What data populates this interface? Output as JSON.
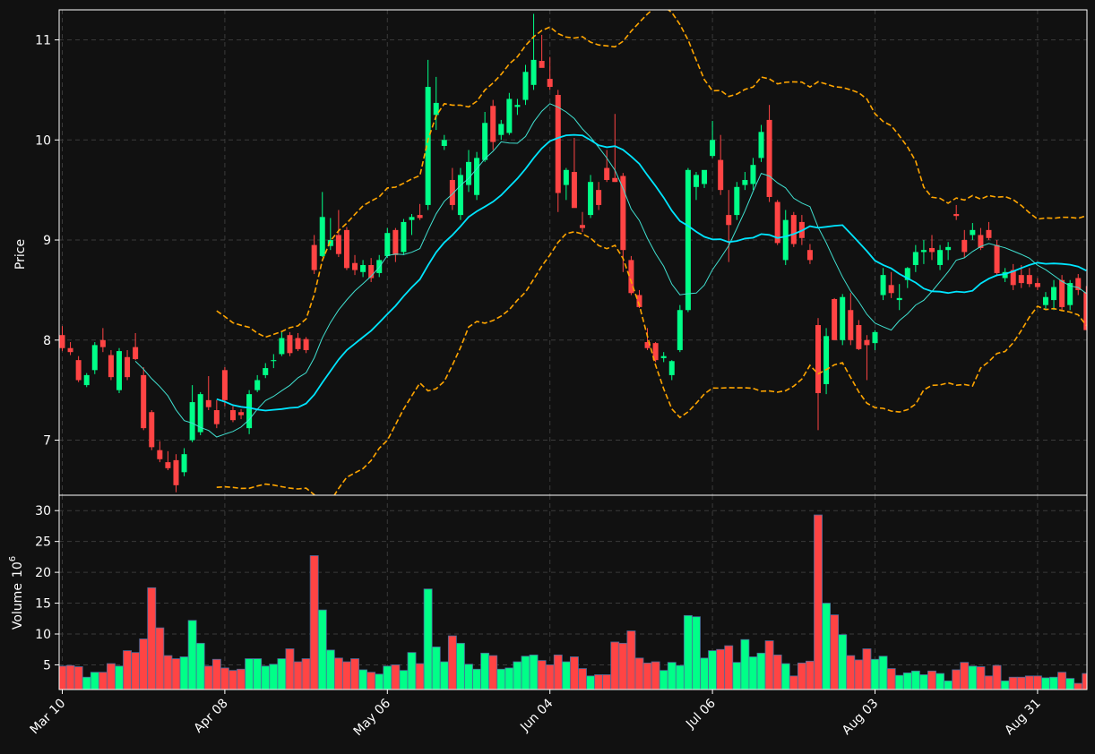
{
  "chart_data": {
    "type": "candlestick",
    "panels": [
      {
        "name": "price",
        "ylabel": "Price",
        "ylim": [
          6.45,
          11.3
        ],
        "yticks": [
          7,
          8,
          9,
          10,
          11
        ]
      },
      {
        "name": "volume",
        "ylabel": "Volume",
        "ylabel_exponent": "10",
        "ylabel_exponent_power": "6",
        "ylim": [
          1,
          32.5
        ],
        "yticks": [
          5,
          10,
          15,
          20,
          25,
          30
        ]
      }
    ],
    "grid": true,
    "xtick_labels": [
      "Mar 10",
      "Apr 08",
      "May 06",
      "Jun 04",
      "Jul 06",
      "Aug 03",
      "Aug 31"
    ],
    "xtick_indices": [
      0,
      20,
      40,
      60,
      80,
      100,
      120
    ],
    "colors": {
      "up": "#00ff88",
      "down": "#ff4444",
      "ma_short": "#40e0d0",
      "ma_long": "#00e5ff",
      "bands": "#ffa500",
      "background": "#111111",
      "grid": "#3a3a3a",
      "axis": "#ffffff",
      "volume_edge": "#4a6b9b"
    },
    "moving_averages": [
      {
        "window": 10,
        "style": "thin"
      },
      {
        "window": 20,
        "style": "thick"
      }
    ],
    "bollinger": {
      "window": 20,
      "k": 2
    },
    "candles": [
      [
        8.05,
        8.14,
        7.89,
        7.92
      ],
      [
        7.92,
        7.98,
        7.85,
        7.88
      ],
      [
        7.8,
        7.84,
        7.58,
        7.6
      ],
      [
        7.55,
        7.67,
        7.53,
        7.65
      ],
      [
        7.7,
        7.98,
        7.66,
        7.95
      ],
      [
        8.0,
        8.12,
        7.88,
        7.93
      ],
      [
        7.85,
        7.9,
        7.6,
        7.63
      ],
      [
        7.5,
        7.92,
        7.47,
        7.89
      ],
      [
        7.83,
        7.9,
        7.6,
        7.63
      ],
      [
        7.93,
        8.07,
        7.8,
        7.81
      ],
      [
        7.65,
        7.73,
        7.1,
        7.12
      ],
      [
        7.28,
        7.3,
        6.9,
        6.93
      ],
      [
        6.9,
        6.99,
        6.78,
        6.81
      ],
      [
        6.78,
        6.89,
        6.7,
        6.72
      ],
      [
        6.8,
        6.86,
        6.48,
        6.55
      ],
      [
        6.68,
        6.92,
        6.64,
        6.86
      ],
      [
        7.0,
        7.55,
        6.98,
        7.38
      ],
      [
        7.08,
        7.48,
        7.05,
        7.46
      ],
      [
        7.4,
        7.64,
        7.3,
        7.33
      ],
      [
        7.3,
        7.4,
        7.12,
        7.16
      ],
      [
        7.7,
        7.73,
        7.34,
        7.4
      ],
      [
        7.3,
        7.34,
        7.18,
        7.2
      ],
      [
        7.28,
        7.31,
        7.21,
        7.25
      ],
      [
        7.12,
        7.5,
        7.06,
        7.46
      ],
      [
        7.5,
        7.65,
        7.48,
        7.6
      ],
      [
        7.65,
        7.77,
        7.62,
        7.72
      ],
      [
        7.79,
        7.86,
        7.72,
        7.8
      ],
      [
        7.86,
        8.08,
        7.84,
        8.02
      ],
      [
        8.05,
        8.08,
        7.84,
        7.87
      ],
      [
        8.02,
        8.07,
        7.89,
        7.91
      ],
      [
        8.01,
        8.03,
        7.87,
        7.9
      ],
      [
        8.95,
        9.05,
        8.66,
        8.7
      ],
      [
        8.84,
        9.48,
        8.83,
        9.23
      ],
      [
        8.94,
        9.22,
        8.9,
        9.0
      ],
      [
        9.05,
        9.3,
        8.83,
        8.86
      ],
      [
        9.1,
        9.13,
        8.7,
        8.72
      ],
      [
        8.77,
        8.85,
        8.65,
        8.7
      ],
      [
        8.68,
        8.8,
        8.63,
        8.75
      ],
      [
        8.75,
        8.82,
        8.58,
        8.62
      ],
      [
        8.67,
        8.85,
        8.63,
        8.8
      ],
      [
        8.84,
        9.12,
        8.82,
        9.07
      ],
      [
        9.1,
        9.12,
        8.78,
        8.85
      ],
      [
        8.88,
        9.21,
        8.85,
        9.18
      ],
      [
        9.2,
        9.26,
        9.05,
        9.23
      ],
      [
        9.25,
        9.36,
        9.2,
        9.22
      ],
      [
        9.35,
        10.8,
        9.3,
        10.53
      ],
      [
        10.25,
        10.63,
        10.1,
        10.37
      ],
      [
        9.94,
        10.05,
        9.9,
        10.0
      ],
      [
        9.6,
        9.72,
        9.3,
        9.35
      ],
      [
        9.25,
        9.72,
        9.2,
        9.65
      ],
      [
        9.55,
        9.9,
        9.48,
        9.78
      ],
      [
        9.45,
        9.88,
        9.4,
        9.82
      ],
      [
        9.8,
        10.28,
        9.78,
        10.17
      ],
      [
        10.34,
        10.4,
        9.9,
        9.98
      ],
      [
        10.05,
        10.2,
        10.0,
        10.16
      ],
      [
        10.07,
        10.47,
        10.05,
        10.41
      ],
      [
        10.33,
        10.41,
        10.25,
        10.35
      ],
      [
        10.4,
        10.75,
        10.35,
        10.68
      ],
      [
        10.55,
        11.26,
        10.5,
        10.8
      ],
      [
        10.79,
        11.05,
        10.74,
        10.72
      ],
      [
        10.61,
        10.83,
        10.5,
        10.53
      ],
      [
        10.45,
        10.5,
        9.28,
        9.47
      ],
      [
        9.55,
        9.72,
        9.4,
        9.7
      ],
      [
        9.68,
        10.02,
        9.38,
        9.32
      ],
      [
        9.15,
        9.28,
        9.08,
        9.12
      ],
      [
        9.25,
        9.65,
        9.22,
        9.58
      ],
      [
        9.5,
        9.58,
        9.3,
        9.35
      ],
      [
        9.72,
        9.9,
        9.58,
        9.6
      ],
      [
        9.62,
        10.26,
        9.58,
        9.58
      ],
      [
        9.64,
        9.67,
        8.68,
        8.9
      ],
      [
        8.8,
        8.84,
        8.45,
        8.47
      ],
      [
        8.45,
        8.5,
        8.32,
        8.33
      ],
      [
        7.98,
        8.12,
        7.9,
        7.92
      ],
      [
        7.97,
        7.98,
        7.78,
        7.8
      ],
      [
        7.82,
        7.88,
        7.78,
        7.84
      ],
      [
        7.65,
        7.8,
        7.6,
        7.79
      ],
      [
        7.9,
        8.35,
        7.88,
        8.3
      ],
      [
        8.3,
        9.72,
        8.28,
        9.7
      ],
      [
        9.53,
        9.68,
        9.4,
        9.65
      ],
      [
        9.56,
        9.68,
        9.52,
        9.7
      ],
      [
        9.84,
        10.19,
        9.82,
        10.0
      ],
      [
        9.8,
        10.05,
        9.45,
        9.5
      ],
      [
        9.25,
        9.5,
        8.78,
        9.15
      ],
      [
        9.25,
        9.58,
        9.2,
        9.53
      ],
      [
        9.55,
        9.68,
        9.5,
        9.6
      ],
      [
        9.56,
        9.82,
        9.5,
        9.75
      ],
      [
        9.82,
        10.15,
        9.78,
        10.08
      ],
      [
        10.2,
        10.35,
        9.38,
        9.43
      ],
      [
        9.38,
        9.4,
        8.95,
        8.97
      ],
      [
        8.8,
        9.3,
        8.75,
        9.2
      ],
      [
        9.25,
        9.28,
        8.93,
        8.96
      ],
      [
        9.18,
        9.25,
        8.95,
        9.02
      ],
      [
        8.9,
        8.96,
        8.76,
        8.8
      ],
      [
        8.15,
        8.22,
        7.1,
        7.47
      ],
      [
        7.56,
        8.12,
        7.46,
        8.04
      ],
      [
        8.41,
        8.42,
        8.05,
        8.0
      ],
      [
        8.0,
        8.46,
        7.95,
        8.43
      ],
      [
        8.3,
        8.47,
        7.95,
        8.0
      ],
      [
        8.15,
        8.2,
        7.9,
        7.91
      ],
      [
        8.0,
        8.05,
        7.6,
        7.95
      ],
      [
        7.97,
        8.1,
        7.9,
        8.08
      ],
      [
        8.45,
        8.72,
        8.4,
        8.65
      ],
      [
        8.55,
        8.68,
        8.42,
        8.47
      ],
      [
        8.4,
        8.56,
        8.3,
        8.42
      ],
      [
        8.6,
        8.73,
        8.52,
        8.72
      ],
      [
        8.75,
        8.95,
        8.68,
        8.88
      ],
      [
        8.88,
        9.0,
        8.76,
        8.9
      ],
      [
        8.92,
        9.05,
        8.8,
        8.88
      ],
      [
        8.75,
        8.95,
        8.7,
        8.9
      ],
      [
        8.9,
        8.98,
        8.8,
        8.93
      ],
      [
        9.26,
        9.35,
        9.2,
        9.24
      ],
      [
        9.0,
        9.1,
        8.82,
        8.88
      ],
      [
        9.05,
        9.17,
        9.0,
        9.1
      ],
      [
        9.05,
        9.12,
        8.9,
        8.92
      ],
      [
        9.1,
        9.18,
        9.0,
        9.02
      ],
      [
        8.95,
        9.0,
        8.64,
        8.67
      ],
      [
        8.62,
        8.72,
        8.58,
        8.68
      ],
      [
        8.7,
        8.76,
        8.5,
        8.55
      ],
      [
        8.65,
        8.75,
        8.52,
        8.57
      ],
      [
        8.65,
        8.72,
        8.53,
        8.56
      ],
      [
        8.57,
        8.62,
        8.5,
        8.53
      ],
      [
        8.35,
        8.48,
        8.3,
        8.43
      ],
      [
        8.4,
        8.6,
        8.3,
        8.53
      ],
      [
        8.6,
        8.65,
        8.3,
        8.33
      ],
      [
        8.35,
        8.6,
        8.3,
        8.57
      ],
      [
        8.62,
        8.66,
        8.45,
        8.5
      ],
      [
        8.48,
        8.54,
        8.1,
        8.1
      ]
    ],
    "volume_millions": [
      4.8,
      4.9,
      4.7,
      3.0,
      3.8,
      3.8,
      5.2,
      4.8,
      7.3,
      7.0,
      9.2,
      17.5,
      11.0,
      6.5,
      6.0,
      6.3,
      12.2,
      8.5,
      4.8,
      5.9,
      4.5,
      4.1,
      4.3,
      6.0,
      6.0,
      4.8,
      5.1,
      6.0,
      7.6,
      5.5,
      6.0,
      22.7,
      13.9,
      7.4,
      6.1,
      5.5,
      6.0,
      4.2,
      3.8,
      3.5,
      4.8,
      5.0,
      4.1,
      7.0,
      5.2,
      17.3,
      7.9,
      5.5,
      9.7,
      8.5,
      5.1,
      4.3,
      6.9,
      6.5,
      4.3,
      4.5,
      5.5,
      6.4,
      6.6,
      5.7,
      5.0,
      6.6,
      5.5,
      6.3,
      4.4,
      3.2,
      3.4,
      3.4,
      8.7,
      8.5,
      10.5,
      6.1,
      5.3,
      5.5,
      4.1,
      5.4,
      4.9,
      13.0,
      12.8,
      6.1,
      7.3,
      7.5,
      8.1,
      5.4,
      9.1,
      6.3,
      6.9,
      8.9,
      6.6,
      5.2,
      3.2,
      5.3,
      5.6,
      29.3,
      15.0,
      13.1,
      9.9,
      6.5,
      5.8,
      7.6,
      5.9,
      6.4,
      4.4,
      3.3,
      3.7,
      4.0,
      3.4,
      4.0,
      3.6,
      2.4,
      4.2,
      5.4,
      4.8,
      4.7,
      3.2,
      4.9,
      2.4,
      3.0,
      3.0,
      3.2,
      3.2,
      2.9,
      3.0,
      3.8,
      2.8,
      2.0,
      3.6
    ]
  }
}
